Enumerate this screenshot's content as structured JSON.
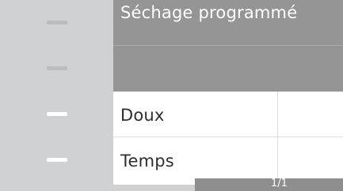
{
  "sidebar": {
    "buttons": [
      {
        "icon": "dash-icon",
        "state": "disabled"
      },
      {
        "icon": "dash-icon",
        "state": "disabled"
      },
      {
        "icon": "dash-icon",
        "state": "enabled"
      },
      {
        "icon": "dash-icon",
        "state": "enabled"
      }
    ]
  },
  "panel": {
    "title": "Séchage programmé",
    "rows": [
      {
        "label": "Doux"
      },
      {
        "label": "Temps"
      }
    ]
  },
  "pagination": {
    "text": "1/1"
  },
  "colors": {
    "sidebar": "#d0d1d2",
    "header": "#959596",
    "accent_dash": "#ffffff"
  }
}
